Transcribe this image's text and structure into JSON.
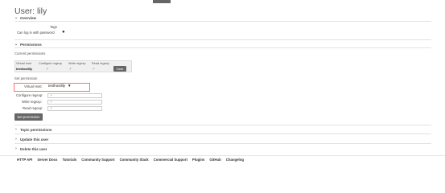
{
  "page": {
    "title": "User: lily"
  },
  "overview": {
    "heading": "Overview",
    "tags_label": "Tags",
    "can_login_label": "Can log in with password",
    "can_login_value": "●"
  },
  "permissions": {
    "heading": "Permissions",
    "current_label": "Current permissions",
    "columns": [
      "Virtual host",
      "Configure regexp",
      "Write regexp",
      "Read regexp"
    ],
    "row": {
      "vhost": "testhostlily",
      "configure": ".*",
      "write": ".*",
      "read": ".*"
    },
    "clear_label": "Clear",
    "set_label": "Set permission",
    "form": {
      "vhost_label": "Virtual Host:",
      "vhost_value": "testhostlily",
      "configure_label": "Configure regexp:",
      "configure_value": ".*",
      "write_label": "Write regexp:",
      "write_value": ".*",
      "read_label": "Read regexp:",
      "read_value": ".*",
      "submit_label": "Set permission"
    }
  },
  "collapsed_sections": [
    "Topic permissions",
    "Update this user",
    "Delete this user"
  ],
  "footer": {
    "links": [
      "HTTP API",
      "Server Docs",
      "Tutorials",
      "Community Support",
      "Community Slack",
      "Commercial Support",
      "Plugins",
      "GitHub",
      "Changelog"
    ]
  }
}
